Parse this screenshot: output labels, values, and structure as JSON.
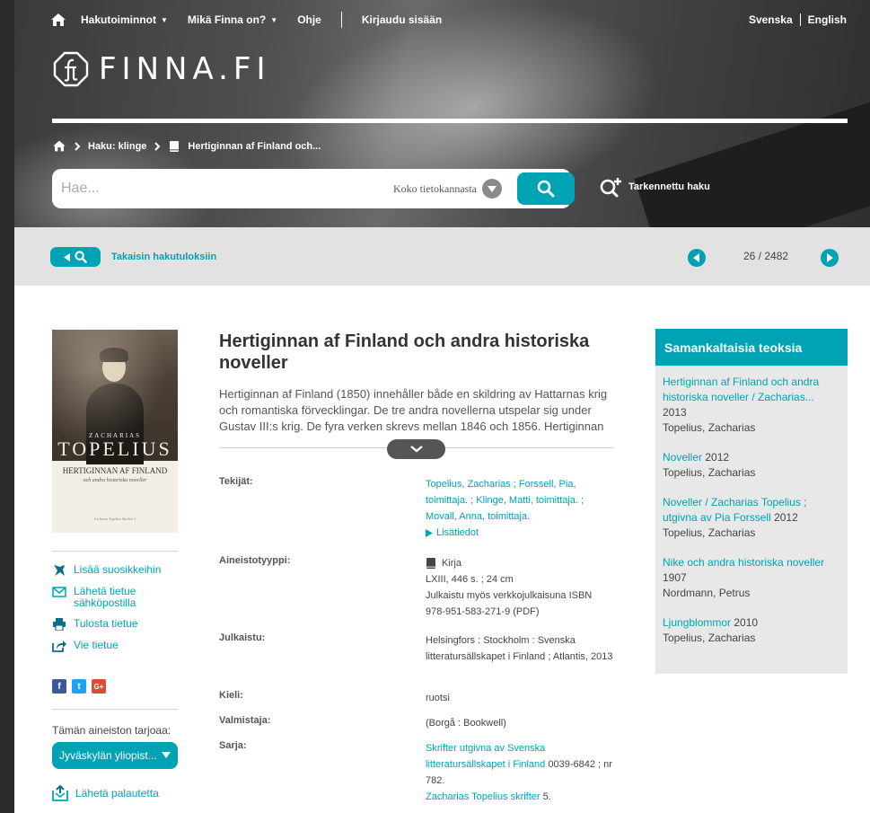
{
  "nav": {
    "items": [
      {
        "label": "Hakutoiminnot",
        "caret": "▼"
      },
      {
        "label": "Mikä Finna on?",
        "caret": "▼"
      },
      {
        "label": "Ohje",
        "caret": ""
      }
    ],
    "login": "Kirjaudu sisään",
    "lang_sv": "Svenska",
    "lang_sep": "|",
    "lang_en": "English"
  },
  "logo": {
    "text": "FINNA.FI"
  },
  "breadcrumb": {
    "search": "Haku: klinge",
    "current": "Hertiginnan af Finland och..."
  },
  "search": {
    "placeholder": "Hae...",
    "scope": "Koko tietokannasta",
    "advanced": "Tarkennettu haku"
  },
  "results": {
    "back_label": "Takaisin hakutuloksiin",
    "position": "26 / 2482"
  },
  "cover": {
    "author_first": "ZACHARIAS",
    "author_last": "TOPELIUS",
    "title": "HERTIGINNAN AF FINLAND",
    "subtitle": "och andra historiska noveller",
    "series": "Zacharias Topelius Skrifter 5"
  },
  "actions": {
    "favorite": "Lisää suosikkeihin",
    "email": "Lähetä tietue sähköpostilla",
    "print": "Tulosta tietue",
    "export": "Vie tietue"
  },
  "social": {
    "facebook": "f",
    "twitter": "t",
    "google": "G+"
  },
  "provider": {
    "label": "Tämän aineiston tarjoaa:",
    "selected": "Jyväskylän yliopist..."
  },
  "feedback": "Lähetä palautetta",
  "record": {
    "title": "Hertiginnan af Finland och andra historiska noveller",
    "summary": "Hertiginnan af Finland (1850) innehåller både en skildring av Hattarnas krig och romantiska förvecklingar. De tre andra novellerna utspelar sig under Gustav III:s krig. De fyra verken skrevs mellan 1846 och 1856. Hertiginnan",
    "fields": {
      "authors_label": "Tekijät:",
      "authors": "Topelius, Zacharias ; Forssell, Pia, toimittaja. ; Klinge, Matti, toimittaja. ; Movall, Anna, toimittaja.",
      "more": "Lisätiedot",
      "format_label": "Aineistotyyppi:",
      "format": "Kirja",
      "extent": "LXIII, 446 s. ; 24 cm",
      "online": "Julkaistu myös verkkojulkaisuna ISBN 978-951-583-271-9 (PDF)",
      "published_label": "Julkaistu:",
      "published": "Helsingfors : Stockholm : Svenska litteratursällskapet i Finland ; Atlantis, 2013",
      "language_label": "Kieli:",
      "language": "ruotsi",
      "manufacturer_label": "Valmistaja:",
      "manufacturer": "(Borgå : Bookwell)",
      "series_label": "Sarja:",
      "series_1_link": "Skrifter utgivna av Svenska litteratursällskapet i Finland",
      "series_1_rest": " 0039-6842 ; nr 782.",
      "series_2_link": "Zacharias Topelius skrifter",
      "series_2_rest": " 5."
    }
  },
  "similar": {
    "heading": "Samankaltaisia teoksia",
    "items": [
      {
        "title": "Hertiginnan af Finland och andra historiska noveller / Zacharias...",
        "year": " 2013",
        "author": "Topelius, Zacharias"
      },
      {
        "title": "Noveller",
        "year": " 2012",
        "author": "Topelius, Zacharias"
      },
      {
        "title": "Noveller / Zacharias Topelius ; utgivna av Pia Forssell",
        "year": " 2012",
        "author": "Topelius, Zacharias"
      },
      {
        "title": "Nike och andra historiska noveller",
        "year": " 1907",
        "author": "Nordmann, Petrus"
      },
      {
        "title": "Ljungblommor",
        "year": " 2010",
        "author": "Topelius, Zacharias"
      }
    ]
  },
  "colors": {
    "accent": "#00a3b4",
    "bar": "#e2e2e2",
    "panel": "#e8e8e8"
  }
}
